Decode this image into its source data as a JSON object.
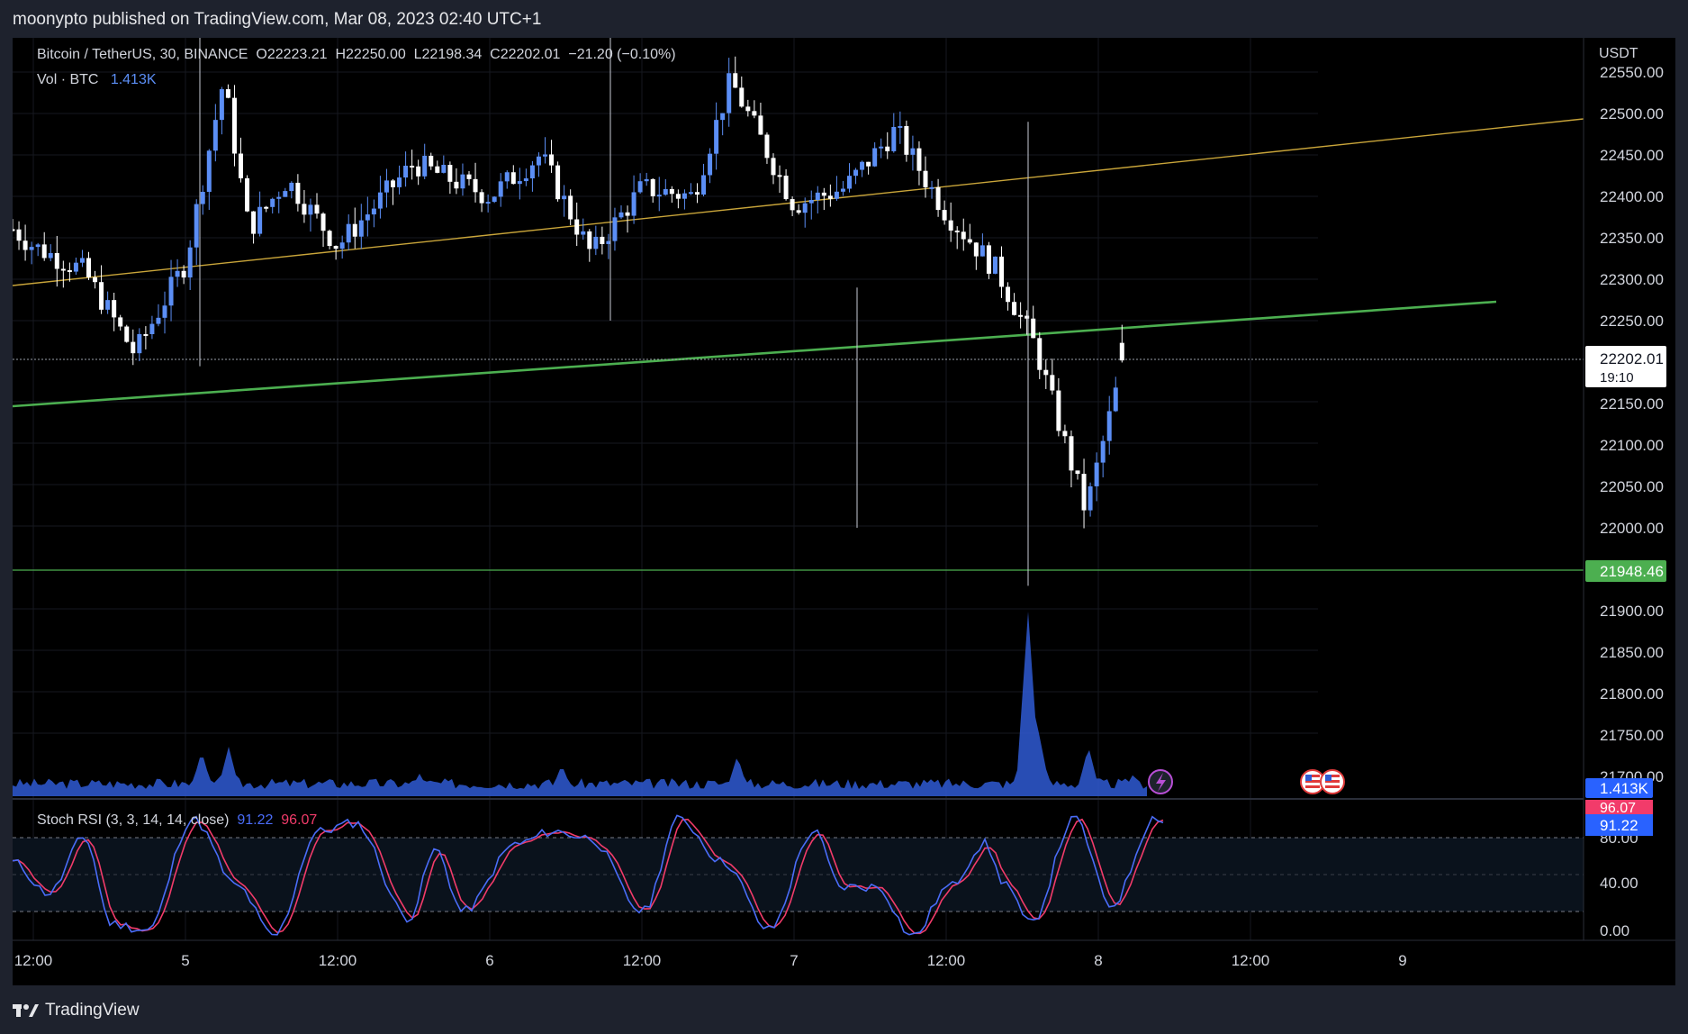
{
  "header": {
    "publish_line": "moonypto published on TradingView.com, Mar 08, 2023 02:40 UTC+1"
  },
  "symbol": {
    "name": "Bitcoin / TetherUS, 30, BINANCE",
    "o_label": "O",
    "o_value": "22223.21",
    "h_label": "H",
    "h_value": "22250.00",
    "l_label": "L",
    "l_value": "22198.34",
    "c_label": "C",
    "c_value": "22202.01",
    "change": "−21.20 (−0.10%)"
  },
  "volume_legend": {
    "label": "Vol · BTC",
    "value": "1.413K"
  },
  "stoch_legend": {
    "label": "Stoch RSI (3, 3, 14, 14, close)",
    "k_value": "91.22",
    "d_value": "96.07"
  },
  "price_axis": {
    "currency": "USDT",
    "ticks": [
      "22550.00",
      "22500.00",
      "22450.00",
      "22400.00",
      "22350.00",
      "22300.00",
      "22250.00",
      "22150.00",
      "22100.00",
      "22050.00",
      "22000.00",
      "21900.00",
      "21850.00",
      "21800.00",
      "21750.00",
      "21700.00"
    ],
    "last_price": "22202.01",
    "countdown": "19:10",
    "level_label": "21948.46",
    "volume_label": "1.413K"
  },
  "stoch_axis": {
    "ticks": [
      "80.00",
      "40.00",
      "0.00"
    ],
    "d_label": "96.07",
    "k_label": "91.22"
  },
  "time_axis": {
    "labels": [
      "12:00",
      "5",
      "12:00",
      "6",
      "12:00",
      "7",
      "12:00",
      "8",
      "12:00",
      "9"
    ]
  },
  "colors": {
    "up_candle": "#5b8ef5",
    "down_candle": "#ffffff",
    "volume": "#2f5bd4",
    "trend_yellow": "#c9a53a",
    "trend_green": "#4caf50",
    "k_line": "#4a6cf7",
    "d_line": "#f23b6a"
  },
  "icons": {
    "event_flash": "lightning-icon",
    "event_us": "us-flag-icon"
  },
  "footer": {
    "brand": "TradingView"
  },
  "chart_data": {
    "type": "candlestick",
    "title": "Bitcoin / TetherUS, 30, BINANCE",
    "ylim": [
      21680,
      22580
    ],
    "price_close_path": [
      {
        "x": "4 10:00",
        "y": 22365
      },
      {
        "x": "4 12:00",
        "y": 22340
      },
      {
        "x": "4 16:00",
        "y": 22310
      },
      {
        "x": "4 20:00",
        "y": 22210
      },
      {
        "x": "5 00:00",
        "y": 22320
      },
      {
        "x": "5 03:00",
        "y": 22540
      },
      {
        "x": "5 05:00",
        "y": 22360
      },
      {
        "x": "5 08:00",
        "y": 22420
      },
      {
        "x": "5 12:00",
        "y": 22340
      },
      {
        "x": "5 18:00",
        "y": 22440
      },
      {
        "x": "6 00:00",
        "y": 22400
      },
      {
        "x": "6 04:00",
        "y": 22450
      },
      {
        "x": "6 08:00",
        "y": 22330
      },
      {
        "x": "6 12:00",
        "y": 22410
      },
      {
        "x": "6 16:00",
        "y": 22400
      },
      {
        "x": "6 19:00",
        "y": 22540
      },
      {
        "x": "6 22:00",
        "y": 22450
      },
      {
        "x": "7 00:00",
        "y": 22390
      },
      {
        "x": "7 04:00",
        "y": 22410
      },
      {
        "x": "7 08:00",
        "y": 22480
      },
      {
        "x": "7 12:00",
        "y": 22380
      },
      {
        "x": "7 16:00",
        "y": 22310
      },
      {
        "x": "7 19:00",
        "y": 22220
      },
      {
        "x": "7 23:00",
        "y": 22020
      },
      {
        "x": "8 02:00",
        "y": 22202.01
      }
    ],
    "volume_btc_last": 1413,
    "trendlines": [
      {
        "name": "yellow",
        "from": {
          "x": "4 10:00",
          "y": 22300
        },
        "to": {
          "x": "9 12:00",
          "y": 22495
        }
      },
      {
        "name": "green",
        "from": {
          "x": "4 10:00",
          "y": 22155
        },
        "to": {
          "x": "9 08:00",
          "y": 22270
        }
      }
    ],
    "horizontal_level": 21948.46,
    "stoch_rsi": {
      "k": 91.22,
      "d": 96.07,
      "upper_band": 80,
      "lower_band": 20,
      "ylim": [
        0,
        100
      ]
    }
  }
}
